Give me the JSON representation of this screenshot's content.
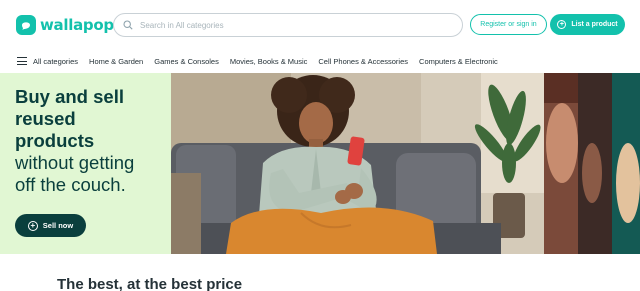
{
  "header": {
    "logo_text": "wallapop",
    "search_placeholder": "Search in All categories",
    "register_label": "Register or sign in",
    "list_product_label": "List a product"
  },
  "categories": {
    "all_label": "All categories",
    "items": [
      "Home & Garden",
      "Games & Consoles",
      "Movies, Books & Music",
      "Cell Phones & Accessories",
      "Computers & Electronic"
    ]
  },
  "hero": {
    "headline_bold": [
      "Buy and sell",
      "reused",
      "products"
    ],
    "headline_light": [
      "without getting",
      "off the couch."
    ],
    "sell_button_label": "Sell now"
  },
  "section": {
    "title": "The best, at the best price"
  },
  "colors": {
    "brand": "#13c1ac",
    "hero_bg": "#e1f7d3",
    "dark_teal": "#0a3f3d"
  }
}
